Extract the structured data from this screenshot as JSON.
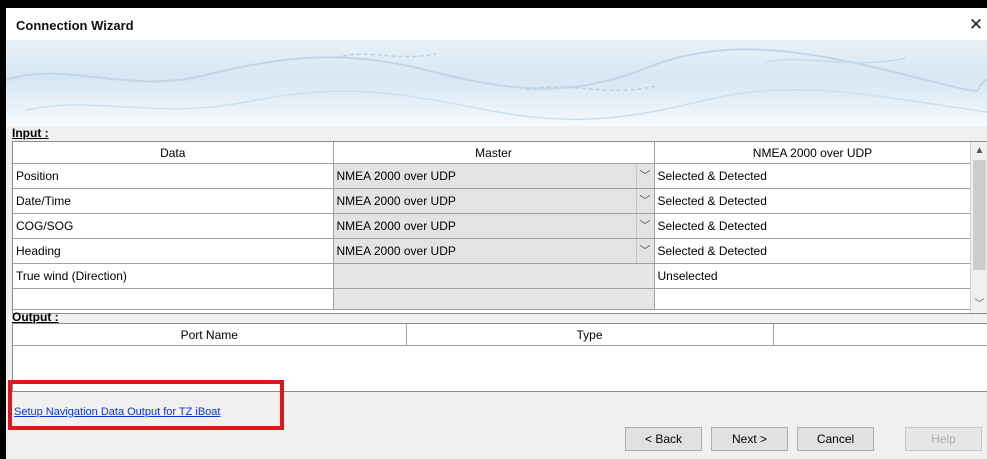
{
  "window": {
    "title": "Connection Wizard",
    "close_glyph": "✕"
  },
  "input": {
    "label": "Input :",
    "columns": [
      "Data",
      "Master",
      "NMEA 2000 over UDP"
    ],
    "rows": [
      {
        "data": "Position",
        "master": "NMEA 2000 over UDP",
        "status": "Selected & Detected"
      },
      {
        "data": "Date/Time",
        "master": "NMEA 2000 over UDP",
        "status": "Selected & Detected"
      },
      {
        "data": "COG/SOG",
        "master": "NMEA 2000 over UDP",
        "status": "Selected & Detected"
      },
      {
        "data": "Heading",
        "master": "NMEA 2000 over UDP",
        "status": "Selected & Detected"
      },
      {
        "data": "True wind (Direction)",
        "master": "",
        "status": "Unselected"
      }
    ]
  },
  "output": {
    "label": "Output :",
    "columns": [
      "Port Name",
      "Type"
    ]
  },
  "setup_link": "Setup Navigation Data Output for TZ iBoat",
  "buttons": {
    "back": "< Back",
    "next": "Next >",
    "cancel": "Cancel",
    "help": "Help"
  },
  "icons": {
    "dropdown_caret": "﹀",
    "scroll_up": "▲",
    "scroll_down": "﹀"
  },
  "colors": {
    "highlight": "#e0161e",
    "link": "#0b36d6"
  }
}
